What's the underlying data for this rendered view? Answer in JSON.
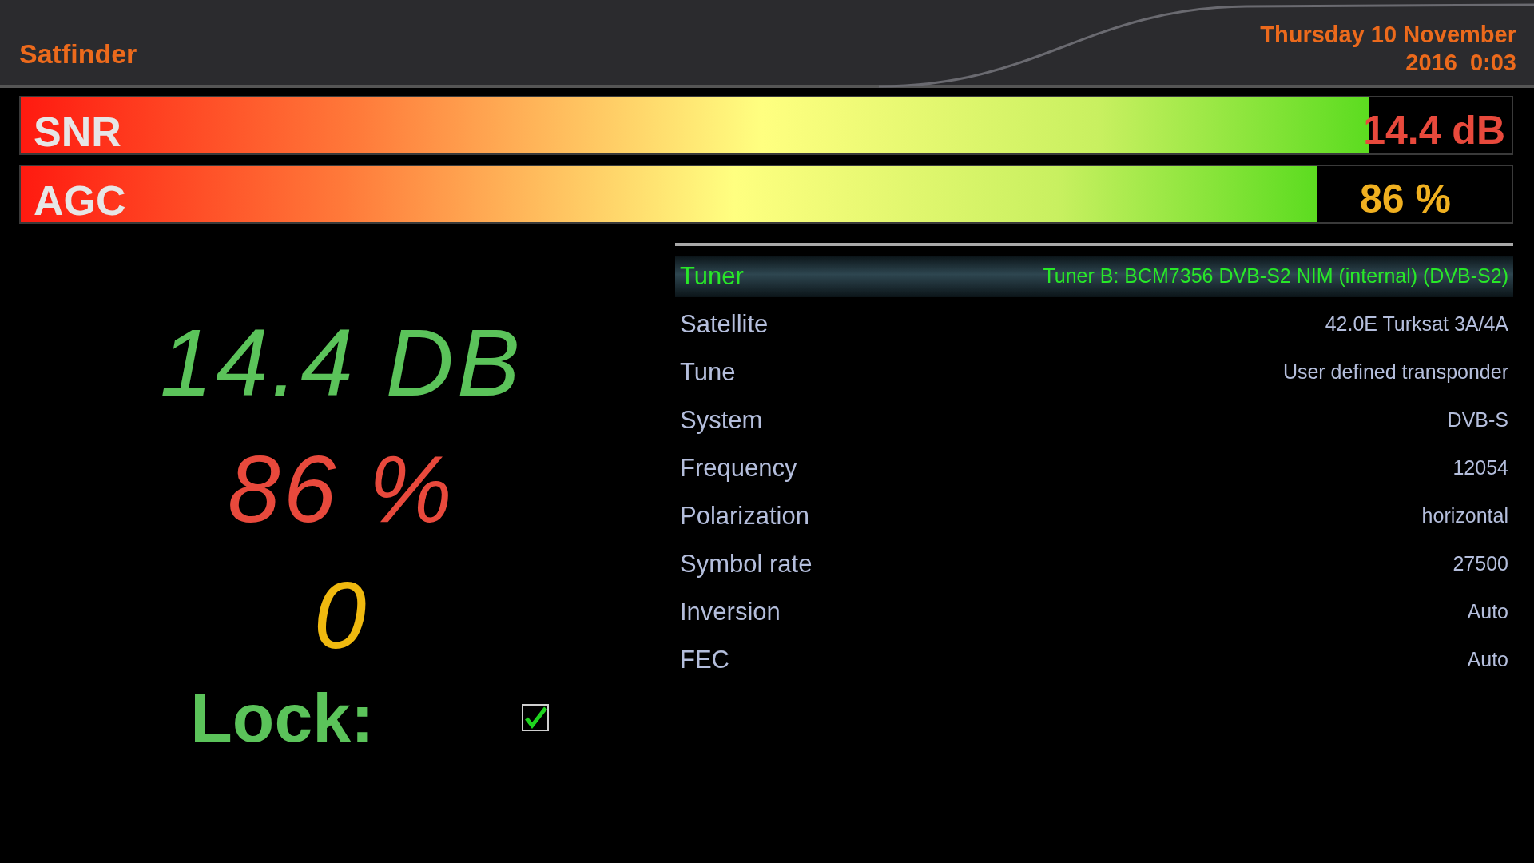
{
  "header": {
    "title": "Satfinder",
    "date": "Thursday 10 November",
    "time": "2016  0:03"
  },
  "bars": [
    {
      "label": "SNR",
      "level": 0.904,
      "reading": "14.4 dB",
      "kind": "overlay"
    },
    {
      "label": "AGC",
      "level": 0.87,
      "reading": "86 %",
      "kind": "aside"
    }
  ],
  "readouts": [
    {
      "text": "14.4 DB",
      "color": "#5bc35a"
    },
    {
      "text": "86 %",
      "color": "#e8493c"
    },
    {
      "text": "0",
      "color": "#f0b90f"
    }
  ],
  "lock": {
    "label": "Lock:",
    "checked": true
  },
  "settings": [
    {
      "label": "Tuner",
      "value": "Tuner B: BCM7356 DVB-S2 NIM (internal) (DVB-S2)",
      "selected": true
    },
    {
      "label": "Satellite",
      "value": "42.0E Turksat 3A/4A",
      "selected": false
    },
    {
      "label": "Tune",
      "value": "User defined transponder",
      "selected": false
    },
    {
      "label": "System",
      "value": "DVB-S",
      "selected": false
    },
    {
      "label": "Frequency",
      "value": "12054",
      "selected": false
    },
    {
      "label": "Polarization",
      "value": "horizontal",
      "selected": false
    },
    {
      "label": "Symbol rate",
      "value": "27500",
      "selected": false
    },
    {
      "label": "Inversion",
      "value": "Auto",
      "selected": false
    },
    {
      "label": "FEC",
      "value": "Auto",
      "selected": false
    }
  ]
}
